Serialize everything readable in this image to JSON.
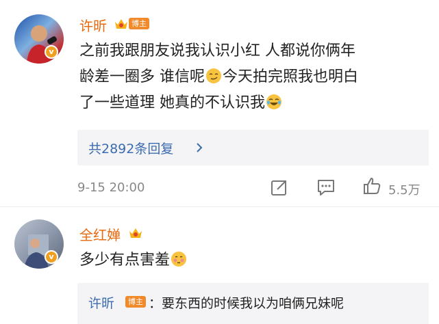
{
  "comment1": {
    "username": "许昕",
    "tag": "博主",
    "text_line1": "之前我跟朋友说我认识小红 人都说你俩年",
    "text_line2a": "龄差一圈多 谁信呢",
    "text_line2b": "今天拍完照我也明白",
    "text_line3": "了一些道理 她真的不认识我",
    "replies_link": "共2892条回复",
    "time": "9-15 20:00",
    "likes": "5.5万",
    "icons": [
      "share-icon",
      "comment-icon",
      "like-icon"
    ]
  },
  "comment2": {
    "username": "全红婵",
    "text": "多少有点害羞",
    "reply": {
      "username": "许昕",
      "tag": "博主",
      "text": "：要东西的时候我以为咱俩兄妹呢"
    }
  },
  "colors": {
    "username": "#e86a10",
    "link": "#3b6bb0",
    "tag_bg": "#f08a2a",
    "meta": "#888888"
  }
}
